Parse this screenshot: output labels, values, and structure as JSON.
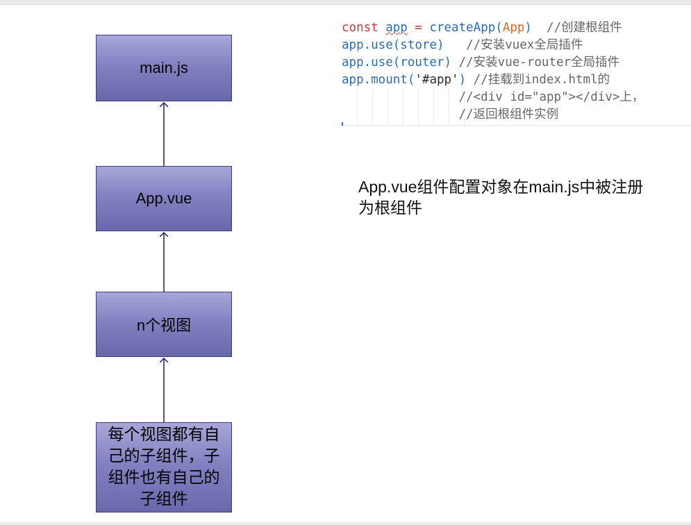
{
  "boxes": {
    "main": "main.js",
    "app": "App.vue",
    "views": "n个视图",
    "children": "每个视图都有自己的子组件，子组件也有自己的子组件"
  },
  "code": {
    "line1": {
      "kw": "const",
      "var": "app",
      "eq": " = ",
      "fn": "createApp(",
      "arg": "App",
      "close": ")",
      "comment": "  //创建根组件"
    },
    "line2": {
      "obj": "app",
      "method": ".use(store)",
      "comment": "   //安装vuex全局插件"
    },
    "line3": {
      "obj": "app",
      "method": ".use(router)",
      "comment": " //安装vue-router全局插件"
    },
    "line4": {
      "obj": "app",
      "method": ".mount(",
      "str": "'#app'",
      "close": ")",
      "comment": " //挂载到index.html的"
    },
    "line5": "                //<div id=\"app\"></div>上，",
    "line6": "                //返回根组件实例"
  },
  "description": "App.vue组件配置对象在main.js中被注册为根组件",
  "colors": {
    "box_top": "#a7a7d8",
    "box_bottom": "#6868ac",
    "arrow": "#2b2b7a",
    "keyword": "#c23b3b",
    "identifier": "#2a6cb3",
    "argument": "#d8671e"
  }
}
